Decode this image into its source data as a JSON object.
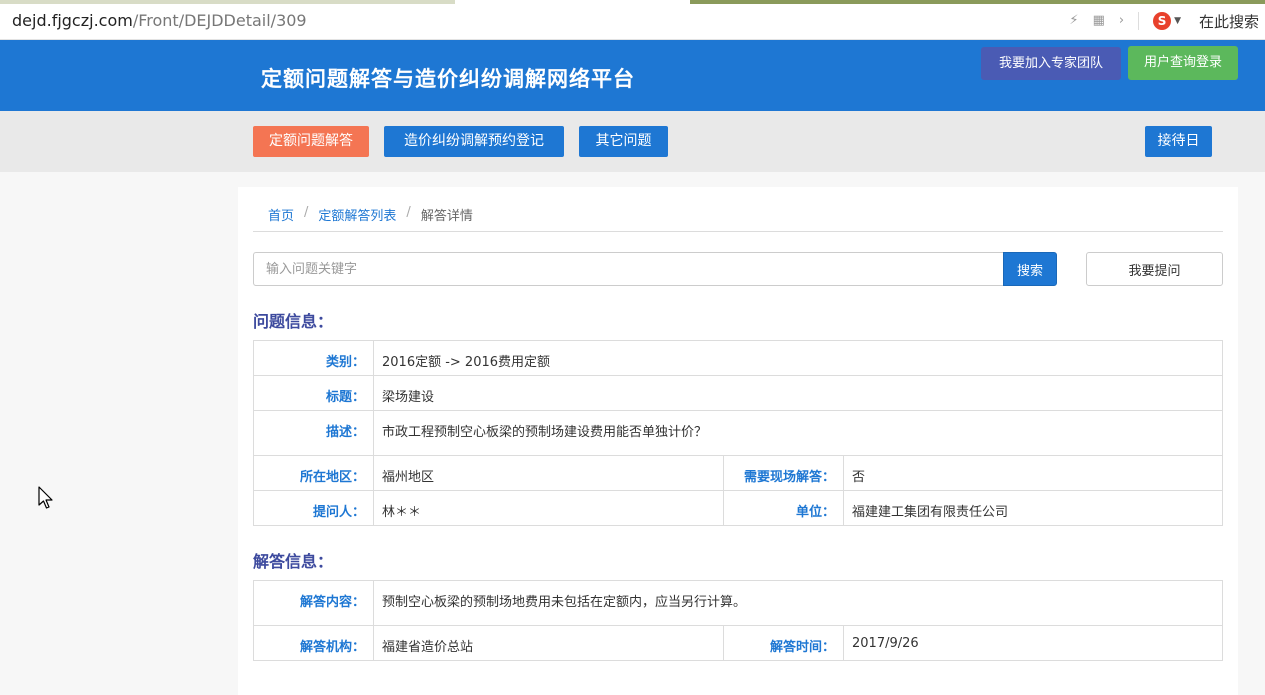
{
  "browser": {
    "url_host": "dejd.fjgczj.com",
    "url_path": "/Front/DEJDDetail/309",
    "search_label": "在此搜索",
    "search_engine_icon": "sogou-s-icon"
  },
  "header": {
    "site_title": "定额问题解答与造价纠纷调解网络平台",
    "join_expert_button": "我要加入专家团队",
    "user_login_button": "用户查询登录"
  },
  "nav": {
    "items": [
      {
        "label": "定额问题解答",
        "active": true
      },
      {
        "label": "造价纠纷调解预约登记",
        "active": false
      },
      {
        "label": "其它问题",
        "active": false
      }
    ],
    "reception_day": "接待日"
  },
  "breadcrumb": {
    "home": "首页",
    "sep": "/",
    "list": "定额解答列表",
    "current": "解答详情"
  },
  "search": {
    "placeholder": "输入问题关键字",
    "search_button": "搜索",
    "ask_button": "我要提问"
  },
  "question": {
    "section_title": "问题信息：",
    "category_label": "类别：",
    "category_value": "2016定额 -> 2016费用定额",
    "title_label": "标题：",
    "title_value": "梁场建设",
    "desc_label": "描述：",
    "desc_value": "市政工程预制空心板梁的预制场建设费用能否单独计价？",
    "region_label": "所在地区：",
    "region_value": "福州地区",
    "onsite_label": "需要现场解答：",
    "onsite_value": "否",
    "asker_label": "提问人：",
    "asker_value": "林＊＊",
    "unit_label": "单位：",
    "unit_value": "福建建工集团有限责任公司"
  },
  "answer": {
    "section_title": "解答信息：",
    "content_label": "解答内容：",
    "content_value": "预制空心板梁的预制场地费用未包括在定额内，应当另行计算。",
    "org_label": "解答机构：",
    "org_value": "福建省造价总站",
    "time_label": "解答时间：",
    "time_value": "2017/9/26"
  },
  "colors": {
    "brand_blue": "#1e77d3",
    "active_orange": "#f47553",
    "expert_purple": "#4a5bb4",
    "login_green": "#5cb85c",
    "section_title": "#3d4a9e"
  }
}
